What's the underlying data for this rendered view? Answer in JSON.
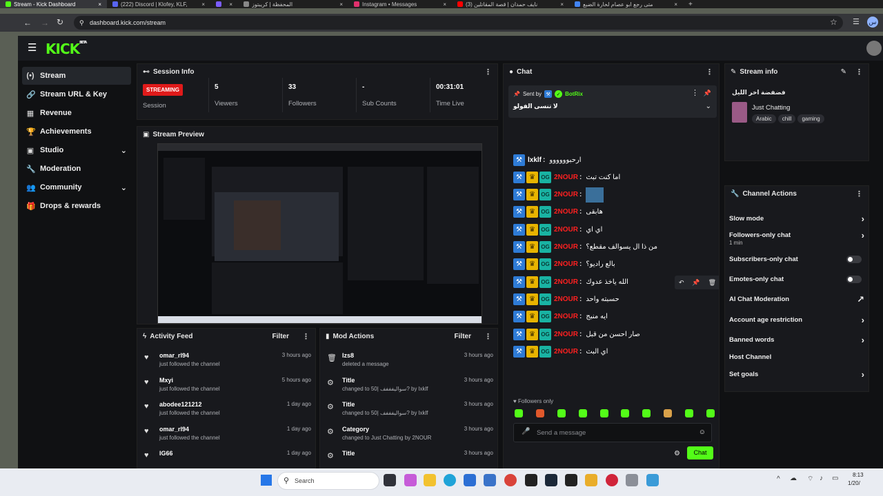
{
  "browser": {
    "tabs": [
      {
        "label": "Stream - Kick Dashboard",
        "color": "#53fc18",
        "active": true
      },
      {
        "label": "(222) Discord | Klofey, KLF,",
        "color": "#5865f2"
      },
      {
        "label": "",
        "color": "#7b5cff"
      },
      {
        "label": "المحفظة | كريبتوز",
        "color": "#888888"
      },
      {
        "label": "Instagram • Messages",
        "color": "#e1306c"
      },
      {
        "label": "(3) نايف حمدان | قصة المقاتلين",
        "color": "#ff0000"
      },
      {
        "label": "متى رجع ابو عصام لحارة الضبع",
        "color": "#4285f4"
      }
    ],
    "new_tab": "+",
    "url": "dashboard.kick.com/stream",
    "profile_initial": "س"
  },
  "app": {
    "logo": "KICK",
    "logo_sup": "BETA",
    "sidebar": [
      {
        "label": "Stream",
        "icon": "(•)",
        "selected": true
      },
      {
        "label": "Stream URL & Key",
        "icon": "🔗"
      },
      {
        "label": "Revenue",
        "icon": "▦"
      },
      {
        "label": "Achievements",
        "icon": "🏆"
      },
      {
        "label": "Studio",
        "icon": "▣",
        "chevron": "⌄"
      },
      {
        "label": "Moderation",
        "icon": "🔧"
      },
      {
        "label": "Community",
        "icon": "👥",
        "chevron": "⌄"
      },
      {
        "label": "Drops & rewards",
        "icon": "🎁"
      }
    ],
    "session": {
      "title": "Session Info",
      "status_badge": "STREAMING",
      "status_label": "Session",
      "stats": [
        {
          "value": "5",
          "label": "Viewers"
        },
        {
          "value": "33",
          "label": "Followers"
        },
        {
          "value": "-",
          "label": "Sub Counts"
        },
        {
          "value": "00:31:01",
          "label": "Time Live"
        }
      ]
    },
    "preview": {
      "title": "Stream Preview"
    },
    "activity": {
      "title": "Activity Feed",
      "filter": "Filter",
      "items": [
        {
          "name": "omar_rl94",
          "desc": "just followed the channel",
          "time": "3 hours ago"
        },
        {
          "name": "Mxyi",
          "desc": "just followed the channel",
          "time": "5 hours ago"
        },
        {
          "name": "abodee121212",
          "desc": "just followed the channel",
          "time": "1 day ago"
        },
        {
          "name": "omar_rl94",
          "desc": "just followed the channel",
          "time": "1 day ago"
        },
        {
          "name": "IG66",
          "desc": "",
          "time": "1 day ago"
        }
      ]
    },
    "mod_actions": {
      "title": "Mod Actions",
      "filter": "Filter",
      "items": [
        {
          "name": "Izs8",
          "desc": "deleted a message",
          "time": "3 hours ago",
          "icon": "🗑"
        },
        {
          "name": "Title",
          "desc": "changed to 50| سواليفففف? by lxklf",
          "time": "3 hours ago",
          "icon": "⚙"
        },
        {
          "name": "Title",
          "desc": "changed to 50| سواليفففف? by lxklf",
          "time": "3 hours ago",
          "icon": "⚙"
        },
        {
          "name": "Category",
          "desc": "changed to Just Chatting by 2NOUR",
          "time": "3 hours ago",
          "icon": "⚙"
        },
        {
          "name": "Title",
          "desc": "",
          "time": "3 hours ago",
          "icon": "⚙"
        }
      ]
    },
    "chat": {
      "title": "Chat",
      "pinned_sent_by": "Sent by",
      "pinned_user": "BotRix",
      "pinned_text": "لا تنسى الفولو",
      "messages": [
        {
          "user": "lxklf",
          "text": "ارحبوووووو",
          "self": true
        },
        {
          "user": "2NOUR",
          "text": "اما كنت تبث"
        },
        {
          "user": "2NOUR",
          "text": "",
          "emote": true
        },
        {
          "user": "2NOUR",
          "text": "هابقى"
        },
        {
          "user": "2NOUR",
          "text": "اي اي"
        },
        {
          "user": "2NOUR",
          "text": "من ذا ال يسوالف مقطع؟"
        },
        {
          "user": "2NOUR",
          "text": "بالع راديو؟"
        },
        {
          "user": "2NOUR",
          "text": "الله ياخذ عدوك"
        },
        {
          "user": "2NOUR",
          "text": "حسبته واحد"
        },
        {
          "user": "2NOUR",
          "text": "ايه منبج"
        },
        {
          "user": "2NOUR",
          "text": "صار احسن من قبل"
        },
        {
          "user": "2NOUR",
          "text": "اي البث"
        }
      ],
      "followers_only": "Followers only",
      "input_placeholder": "Send a message",
      "send": "Chat"
    },
    "stream_info": {
      "title": "Stream info",
      "stream_title": "فضفضة اخر الليل",
      "category": "Just Chatting",
      "tags": [
        "Arabic",
        "chill",
        "gaming"
      ]
    },
    "channel_actions": {
      "title": "Channel Actions",
      "items": [
        {
          "label": "Slow mode",
          "sub": "",
          "ctrl": "›"
        },
        {
          "label": "Followers-only chat",
          "sub": "1 min",
          "ctrl": "›"
        },
        {
          "label": "Subscribers-only chat",
          "sub": "",
          "ctrl": "toggle"
        },
        {
          "label": "Emotes-only chat",
          "sub": "",
          "ctrl": "toggle"
        },
        {
          "label": "AI Chat Moderation",
          "sub": "",
          "ctrl": "↗"
        },
        {
          "label": "Account age restriction",
          "sub": "",
          "ctrl": "›"
        },
        {
          "label": "Banned words",
          "sub": "",
          "ctrl": "›"
        },
        {
          "label": "Host Channel",
          "sub": "",
          "ctrl": ""
        },
        {
          "label": "Set goals",
          "sub": "",
          "ctrl": "›"
        }
      ]
    }
  },
  "taskbar": {
    "search": "Search",
    "time": "8:13",
    "date": "1/20/"
  }
}
